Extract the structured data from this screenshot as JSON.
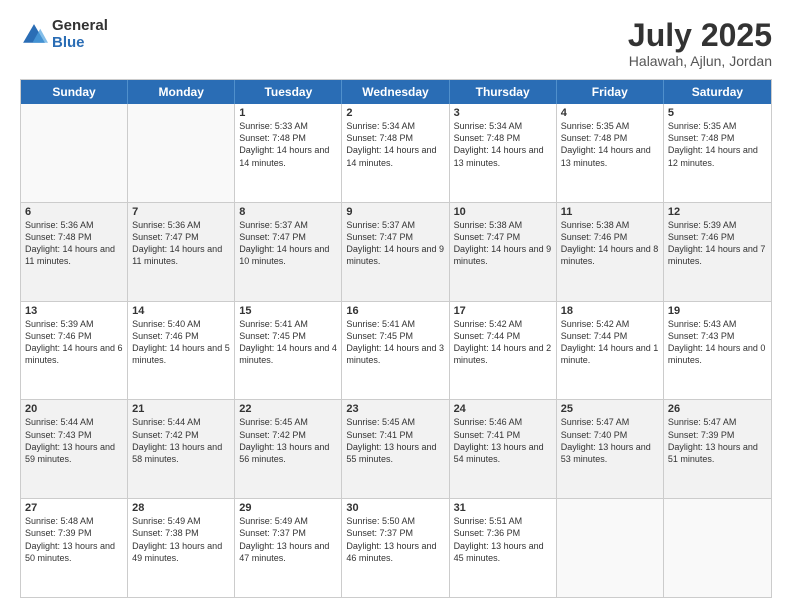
{
  "logo": {
    "general": "General",
    "blue": "Blue"
  },
  "header": {
    "month": "July 2025",
    "location": "Halawah, Ajlun, Jordan"
  },
  "days": [
    "Sunday",
    "Monday",
    "Tuesday",
    "Wednesday",
    "Thursday",
    "Friday",
    "Saturday"
  ],
  "weeks": [
    [
      {
        "day": "",
        "info": ""
      },
      {
        "day": "",
        "info": ""
      },
      {
        "day": "1",
        "info": "Sunrise: 5:33 AM\nSunset: 7:48 PM\nDaylight: 14 hours and 14 minutes."
      },
      {
        "day": "2",
        "info": "Sunrise: 5:34 AM\nSunset: 7:48 PM\nDaylight: 14 hours and 14 minutes."
      },
      {
        "day": "3",
        "info": "Sunrise: 5:34 AM\nSunset: 7:48 PM\nDaylight: 14 hours and 13 minutes."
      },
      {
        "day": "4",
        "info": "Sunrise: 5:35 AM\nSunset: 7:48 PM\nDaylight: 14 hours and 13 minutes."
      },
      {
        "day": "5",
        "info": "Sunrise: 5:35 AM\nSunset: 7:48 PM\nDaylight: 14 hours and 12 minutes."
      }
    ],
    [
      {
        "day": "6",
        "info": "Sunrise: 5:36 AM\nSunset: 7:48 PM\nDaylight: 14 hours and 11 minutes."
      },
      {
        "day": "7",
        "info": "Sunrise: 5:36 AM\nSunset: 7:47 PM\nDaylight: 14 hours and 11 minutes."
      },
      {
        "day": "8",
        "info": "Sunrise: 5:37 AM\nSunset: 7:47 PM\nDaylight: 14 hours and 10 minutes."
      },
      {
        "day": "9",
        "info": "Sunrise: 5:37 AM\nSunset: 7:47 PM\nDaylight: 14 hours and 9 minutes."
      },
      {
        "day": "10",
        "info": "Sunrise: 5:38 AM\nSunset: 7:47 PM\nDaylight: 14 hours and 9 minutes."
      },
      {
        "day": "11",
        "info": "Sunrise: 5:38 AM\nSunset: 7:46 PM\nDaylight: 14 hours and 8 minutes."
      },
      {
        "day": "12",
        "info": "Sunrise: 5:39 AM\nSunset: 7:46 PM\nDaylight: 14 hours and 7 minutes."
      }
    ],
    [
      {
        "day": "13",
        "info": "Sunrise: 5:39 AM\nSunset: 7:46 PM\nDaylight: 14 hours and 6 minutes."
      },
      {
        "day": "14",
        "info": "Sunrise: 5:40 AM\nSunset: 7:46 PM\nDaylight: 14 hours and 5 minutes."
      },
      {
        "day": "15",
        "info": "Sunrise: 5:41 AM\nSunset: 7:45 PM\nDaylight: 14 hours and 4 minutes."
      },
      {
        "day": "16",
        "info": "Sunrise: 5:41 AM\nSunset: 7:45 PM\nDaylight: 14 hours and 3 minutes."
      },
      {
        "day": "17",
        "info": "Sunrise: 5:42 AM\nSunset: 7:44 PM\nDaylight: 14 hours and 2 minutes."
      },
      {
        "day": "18",
        "info": "Sunrise: 5:42 AM\nSunset: 7:44 PM\nDaylight: 14 hours and 1 minute."
      },
      {
        "day": "19",
        "info": "Sunrise: 5:43 AM\nSunset: 7:43 PM\nDaylight: 14 hours and 0 minutes."
      }
    ],
    [
      {
        "day": "20",
        "info": "Sunrise: 5:44 AM\nSunset: 7:43 PM\nDaylight: 13 hours and 59 minutes."
      },
      {
        "day": "21",
        "info": "Sunrise: 5:44 AM\nSunset: 7:42 PM\nDaylight: 13 hours and 58 minutes."
      },
      {
        "day": "22",
        "info": "Sunrise: 5:45 AM\nSunset: 7:42 PM\nDaylight: 13 hours and 56 minutes."
      },
      {
        "day": "23",
        "info": "Sunrise: 5:45 AM\nSunset: 7:41 PM\nDaylight: 13 hours and 55 minutes."
      },
      {
        "day": "24",
        "info": "Sunrise: 5:46 AM\nSunset: 7:41 PM\nDaylight: 13 hours and 54 minutes."
      },
      {
        "day": "25",
        "info": "Sunrise: 5:47 AM\nSunset: 7:40 PM\nDaylight: 13 hours and 53 minutes."
      },
      {
        "day": "26",
        "info": "Sunrise: 5:47 AM\nSunset: 7:39 PM\nDaylight: 13 hours and 51 minutes."
      }
    ],
    [
      {
        "day": "27",
        "info": "Sunrise: 5:48 AM\nSunset: 7:39 PM\nDaylight: 13 hours and 50 minutes."
      },
      {
        "day": "28",
        "info": "Sunrise: 5:49 AM\nSunset: 7:38 PM\nDaylight: 13 hours and 49 minutes."
      },
      {
        "day": "29",
        "info": "Sunrise: 5:49 AM\nSunset: 7:37 PM\nDaylight: 13 hours and 47 minutes."
      },
      {
        "day": "30",
        "info": "Sunrise: 5:50 AM\nSunset: 7:37 PM\nDaylight: 13 hours and 46 minutes."
      },
      {
        "day": "31",
        "info": "Sunrise: 5:51 AM\nSunset: 7:36 PM\nDaylight: 13 hours and 45 minutes."
      },
      {
        "day": "",
        "info": ""
      },
      {
        "day": "",
        "info": ""
      }
    ]
  ]
}
